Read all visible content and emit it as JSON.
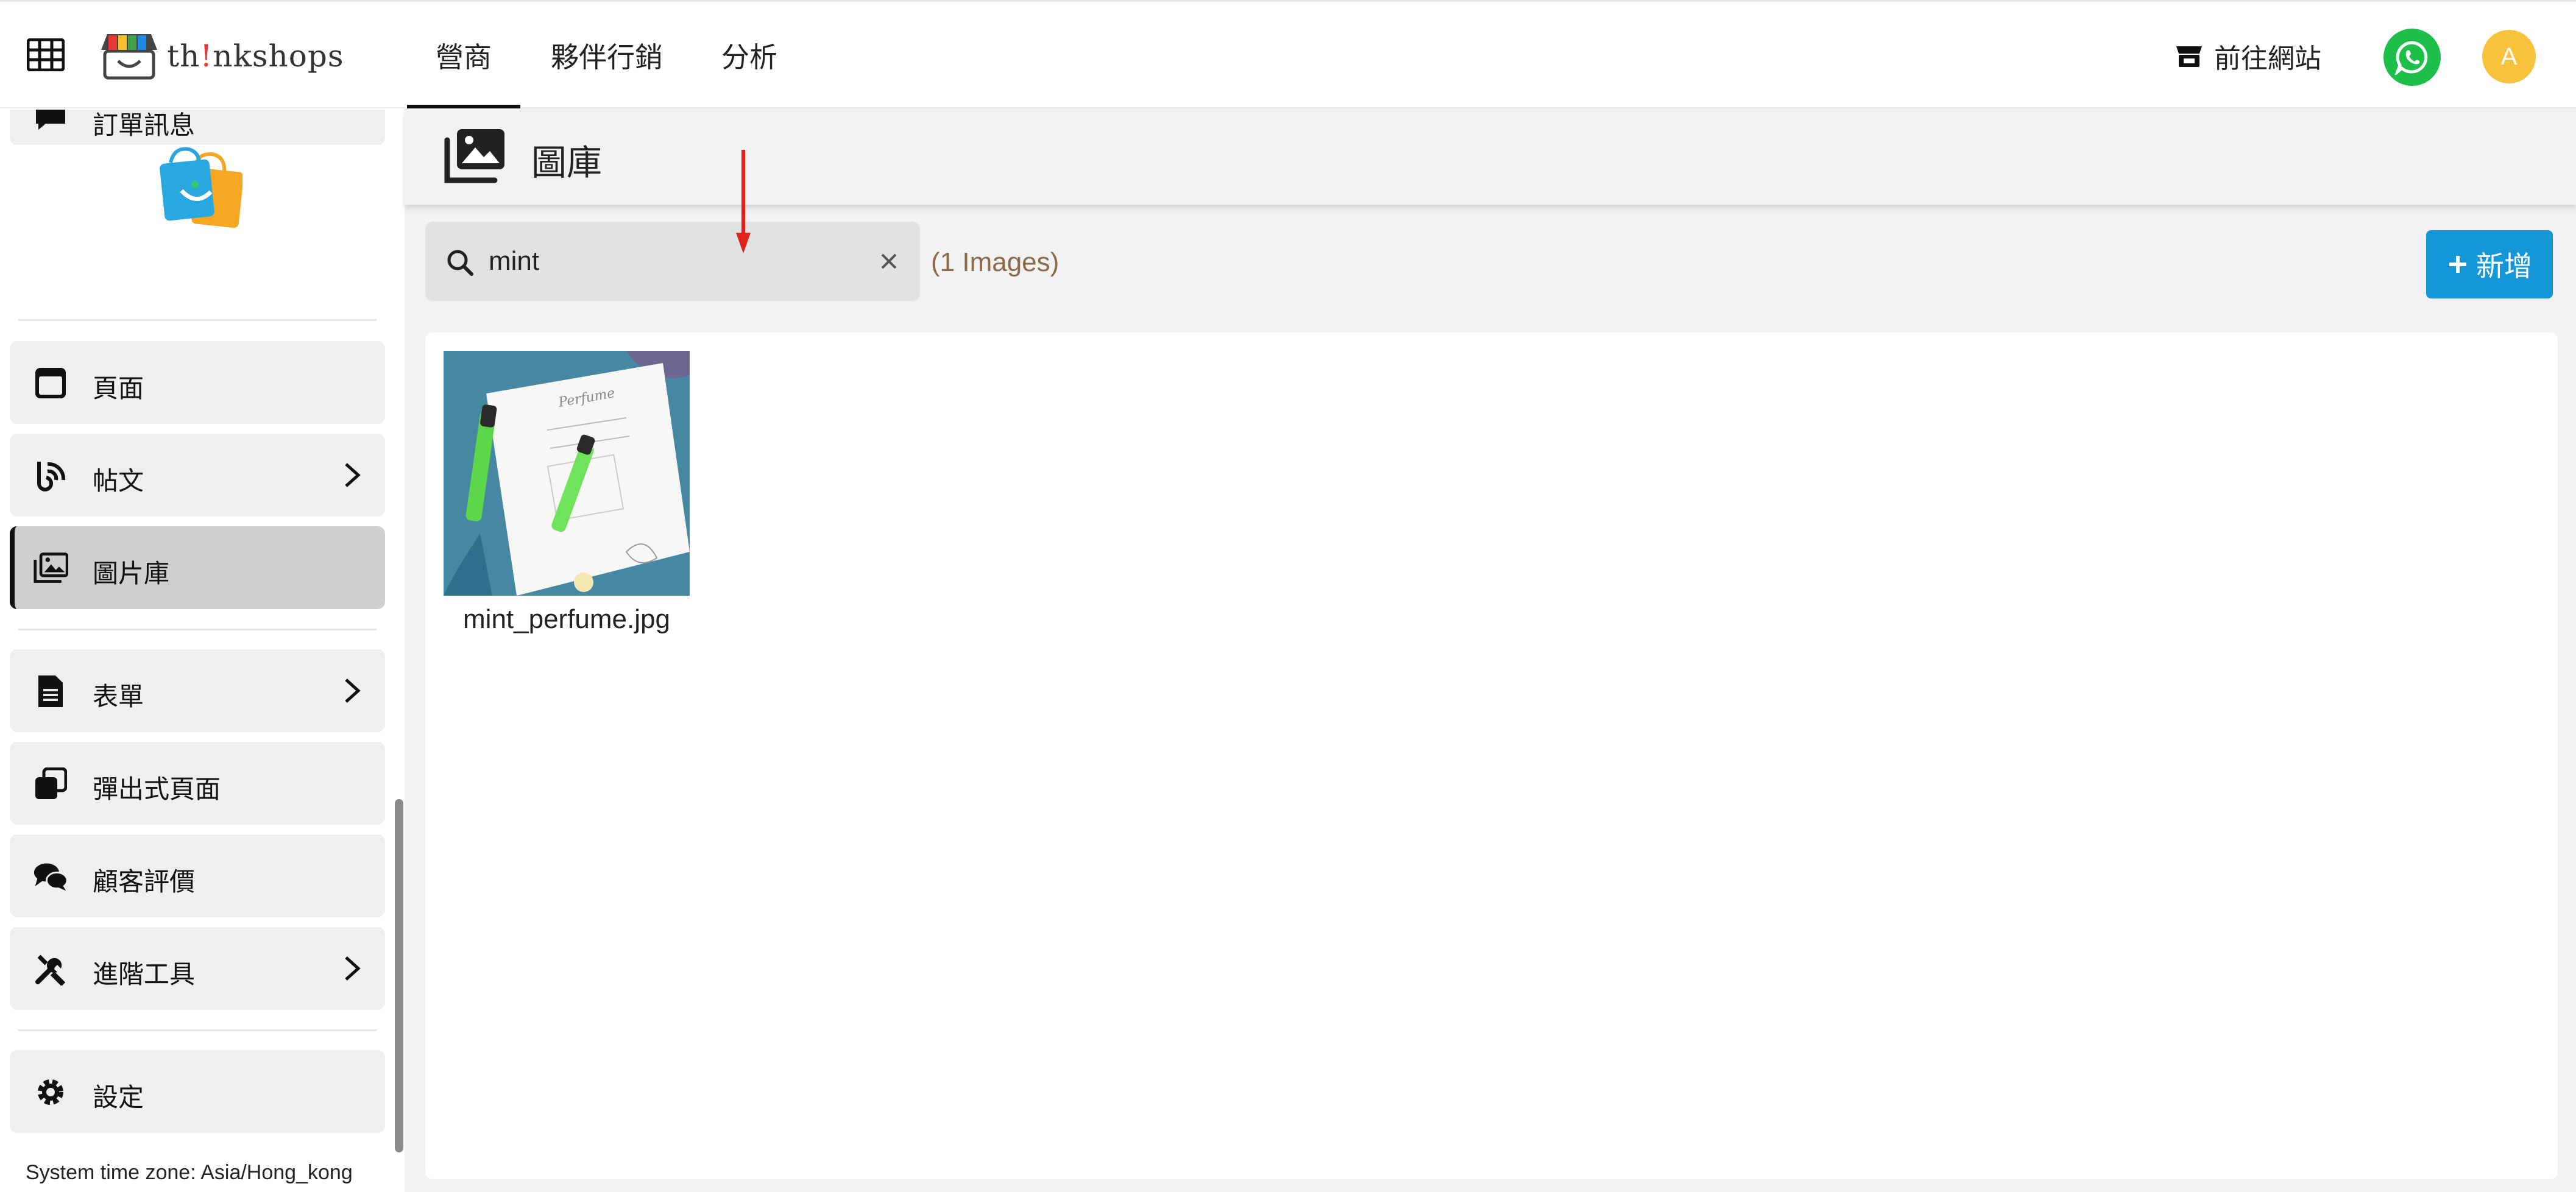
{
  "topbar": {
    "brand_text_a": "th",
    "brand_text_bang": "!",
    "brand_text_b": "nkshops",
    "tabs": [
      {
        "label": "營商",
        "active": true
      },
      {
        "label": "夥伴行銷",
        "active": false
      },
      {
        "label": "分析",
        "active": false
      }
    ],
    "goto_site_label": "前往網站",
    "avatar_initial": "A"
  },
  "sidebar": {
    "items": [
      {
        "label": "訂單訊息",
        "icon": "message-icon"
      },
      {
        "label": "頁面",
        "icon": "page-icon"
      },
      {
        "label": "帖文",
        "icon": "blog-icon",
        "chevron": true
      },
      {
        "label": "圖片庫",
        "icon": "images-icon",
        "active": true
      },
      {
        "label": "表單",
        "icon": "form-icon",
        "chevron": true
      },
      {
        "label": "彈出式頁面",
        "icon": "popup-icon"
      },
      {
        "label": "顧客評價",
        "icon": "reviews-icon"
      },
      {
        "label": "進階工具",
        "icon": "tools-icon",
        "chevron": true
      },
      {
        "label": "設定",
        "icon": "gear-icon"
      }
    ],
    "timezone": "System time zone: Asia/Hong_kong"
  },
  "main": {
    "title": "圖庫",
    "search": {
      "value": "mint"
    },
    "count_text": "(1 Images)",
    "add_label": "新增",
    "images": [
      {
        "name": "mint_perfume.jpg"
      }
    ]
  },
  "colors": {
    "primary": "#1596d8",
    "whatsapp": "#1ebe4b",
    "avatar": "#f9c23c",
    "annotation_arrow": "#e0201a"
  }
}
